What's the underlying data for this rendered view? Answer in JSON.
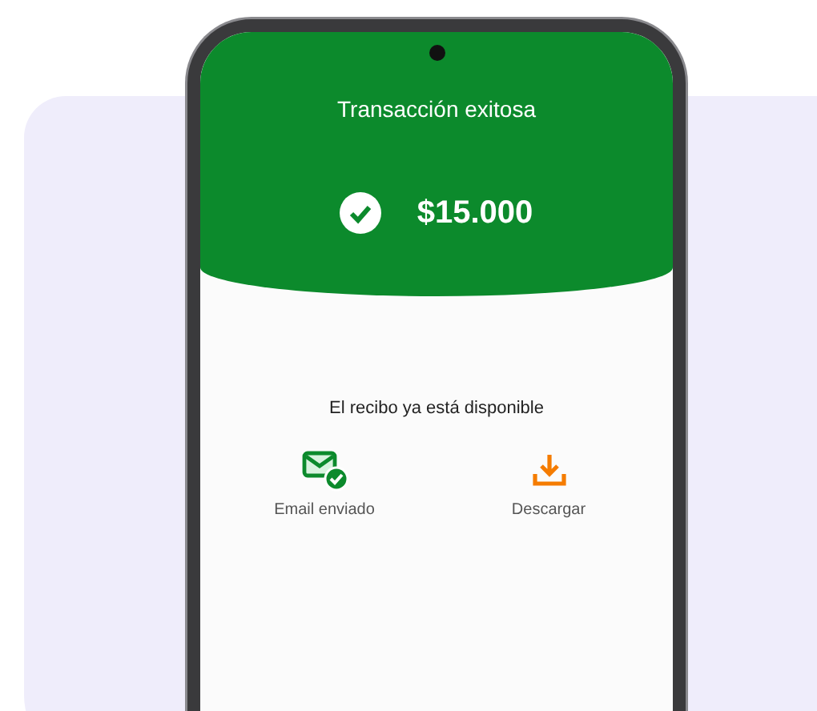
{
  "header": {
    "title": "Transacción exitosa",
    "amount": "$15.000"
  },
  "receipt": {
    "message": "El recibo ya está disponible",
    "actions": [
      {
        "kind": "email",
        "label": "Email enviado"
      },
      {
        "kind": "download",
        "label": "Descargar"
      }
    ]
  }
}
